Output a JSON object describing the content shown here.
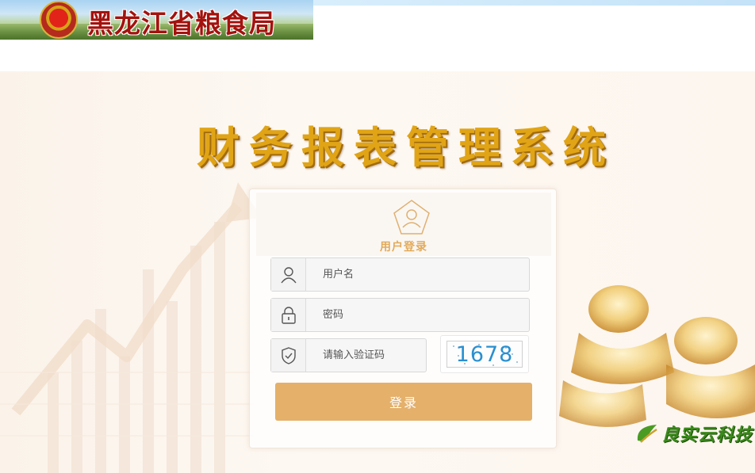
{
  "header": {
    "emblem_text": "国徽",
    "org_name": "黑龙江省粮食局"
  },
  "system_title": "财务报表管理系统",
  "login": {
    "title": "用户登录",
    "username_placeholder": "用户名",
    "password_placeholder": "密码",
    "captcha_placeholder": "请输入验证码",
    "captcha_code": "1678",
    "submit_label": "登录"
  },
  "brand": {
    "name": "良实云科技"
  },
  "icons": {
    "user": "user-icon",
    "lock": "lock-icon",
    "shield": "shield-icon"
  },
  "colors": {
    "accent": "#e4b06a",
    "title_gold": "#e0a416",
    "org_red": "#a3120e",
    "brand_green": "#3b8a1c"
  }
}
